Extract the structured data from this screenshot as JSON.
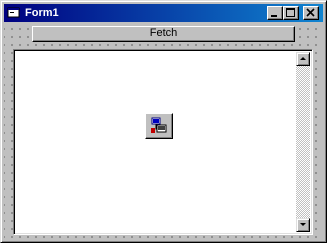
{
  "window": {
    "title": "Form1",
    "icon": "form-icon",
    "caption_buttons": [
      "minimize-icon",
      "maximize-icon",
      "close-icon"
    ]
  },
  "form": {
    "fetch_button_label": "Fetch",
    "list_scroll_icons": [
      "scroll-up-arrow-icon",
      "scroll-down-arrow-icon"
    ],
    "component_icon": "network-control-icon"
  },
  "colors": {
    "title_start": "#000080",
    "title_end": "#1084d0",
    "face": "#c0c0c0",
    "list_bg": "#ffffff"
  }
}
